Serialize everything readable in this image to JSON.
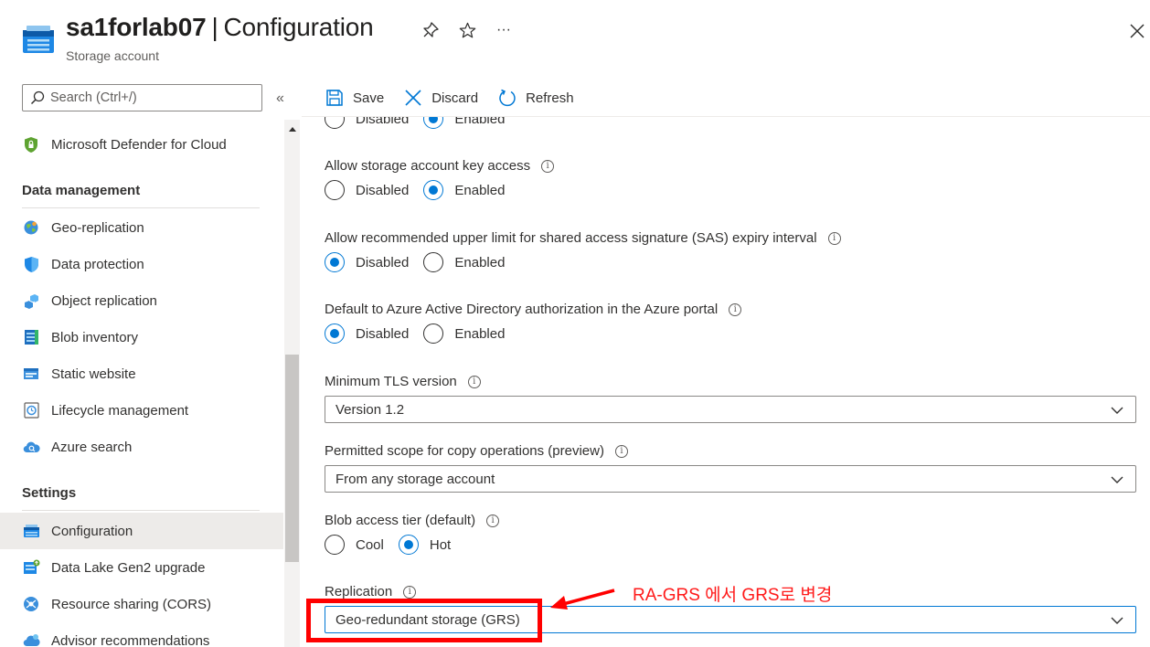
{
  "header": {
    "resource_name": "sa1forlab07",
    "separator": "|",
    "page_name": "Configuration",
    "subtitle": "Storage account",
    "more_label": "···"
  },
  "sidebar": {
    "search_placeholder": "Search (Ctrl+/)",
    "collapse_label": "«",
    "top_item": "Microsoft Defender for Cloud",
    "sections": [
      {
        "title": "Data management",
        "items": [
          "Geo-replication",
          "Data protection",
          "Object replication",
          "Blob inventory",
          "Static website",
          "Lifecycle management",
          "Azure search"
        ]
      },
      {
        "title": "Settings",
        "items": [
          "Configuration",
          "Data Lake Gen2 upgrade",
          "Resource sharing (CORS)",
          "Advisor recommendations"
        ]
      }
    ],
    "active_item": "Configuration"
  },
  "toolbar": {
    "save": "Save",
    "discard": "Discard",
    "refresh": "Refresh"
  },
  "settings": {
    "partial": {
      "disabled": "Disabled",
      "enabled": "Enabled",
      "selected": "enabled"
    },
    "key_access": {
      "label": "Allow storage account key access",
      "disabled": "Disabled",
      "enabled": "Enabled",
      "selected": "enabled"
    },
    "sas_limit": {
      "label": "Allow recommended upper limit for shared access signature (SAS) expiry interval",
      "disabled": "Disabled",
      "enabled": "Enabled",
      "selected": "disabled"
    },
    "aad_default": {
      "label": "Default to Azure Active Directory authorization in the Azure portal",
      "disabled": "Disabled",
      "enabled": "Enabled",
      "selected": "disabled"
    },
    "tls": {
      "label": "Minimum TLS version",
      "value": "Version 1.2"
    },
    "copy_scope": {
      "label": "Permitted scope for copy operations (preview)",
      "value": "From any storage account"
    },
    "access_tier": {
      "label": "Blob access tier (default)",
      "cool": "Cool",
      "hot": "Hot",
      "selected": "hot"
    },
    "replication": {
      "label": "Replication",
      "value": "Geo-redundant storage (GRS)"
    }
  },
  "annotation": {
    "text": "RA-GRS 에서 GRS로 변경",
    "color": "#ff0000"
  },
  "colors": {
    "accent": "#0078d4",
    "text": "#323130"
  }
}
